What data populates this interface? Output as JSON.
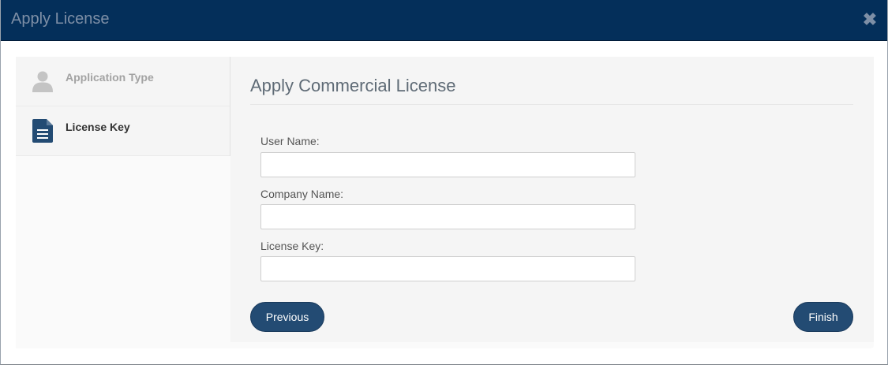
{
  "dialog": {
    "title": "Apply License",
    "close_icon": "close-icon"
  },
  "steps": [
    {
      "label": "Application Type",
      "icon": "user-icon",
      "state": "inactive"
    },
    {
      "label": "License Key",
      "icon": "document-icon",
      "state": "active"
    }
  ],
  "form": {
    "heading": "Apply Commercial License",
    "fields": [
      {
        "label": "User Name:",
        "value": "",
        "placeholder": ""
      },
      {
        "label": "Company Name:",
        "value": "",
        "placeholder": ""
      },
      {
        "label": "License Key:",
        "value": "",
        "placeholder": ""
      }
    ]
  },
  "buttons": {
    "previous": "Previous",
    "finish": "Finish"
  },
  "colors": {
    "titlebar": "#042f5a",
    "button": "#234b73",
    "active_step_icon": "#234b73",
    "inactive_step_icon": "#c4c4c4"
  }
}
